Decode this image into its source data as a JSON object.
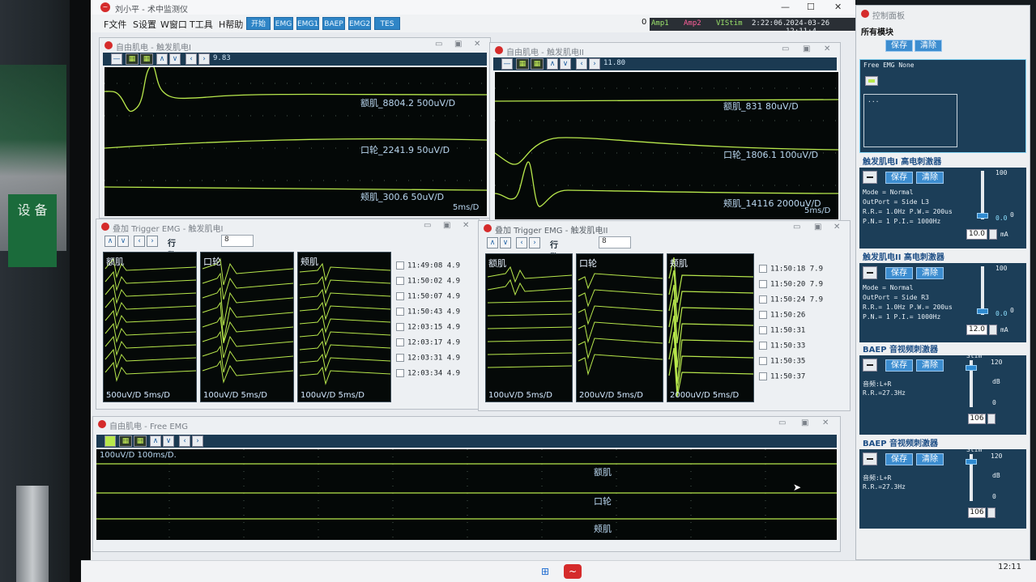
{
  "app": {
    "title": "刘小平 - 术中监测仪",
    "menu": [
      "F文件",
      "S设置",
      "W窗口",
      "T工具",
      "H帮助"
    ],
    "toolbar_buttons": [
      "开始",
      "EMG",
      "EMG1",
      "BAEP",
      "EMG2",
      "TES"
    ],
    "status": {
      "count": "0",
      "amp1": "Amp1",
      "amp2": "Amp2",
      "vistim": "VIStim",
      "elapsed": "2:22:06.",
      "datetime": "2024-03-26 12:11:4"
    }
  },
  "win1": {
    "title": "自由肌电 - 触发肌电I",
    "cursor_value": "9.83",
    "channels": [
      {
        "label": "额肌_8804.2  500uV/D"
      },
      {
        "label": "口轮_2241.9  50uV/D"
      },
      {
        "label": "颊肌_300.6  50uV/D"
      }
    ],
    "timebase": "5ms/D"
  },
  "win2": {
    "title": "自由肌电 - 触发肌电II",
    "cursor_value": "11.80",
    "channels": [
      {
        "label": "额肌_831  80uV/D"
      },
      {
        "label": "口轮_1806.1  100uV/D"
      },
      {
        "label": "颊肌_14116  2000uV/D"
      }
    ],
    "timebase": "5ms/D"
  },
  "trig1": {
    "title": "叠加 Trigger EMG - 触发肌电I",
    "rows_label": "行数",
    "rows_value": "8",
    "panels": [
      {
        "name": "额肌",
        "scale": "500uV/D 5ms/D"
      },
      {
        "name": "口轮",
        "scale": "100uV/D 5ms/D"
      },
      {
        "name": "颊肌",
        "scale": "100uV/D 5ms/D"
      }
    ],
    "entries": [
      "11:49:08 4.9",
      "11:50:02 4.9",
      "11:50:07 4.9",
      "11:50:43 4.9",
      "12:03:15 4.9",
      "12:03:17 4.9",
      "12:03:31 4.9",
      "12:03:34 4.9"
    ]
  },
  "trig2": {
    "title": "叠加 Trigger EMG - 触发肌电II",
    "rows_label": "行数",
    "rows_value": "8",
    "panels": [
      {
        "name": "额肌",
        "scale": "100uV/D 5ms/D"
      },
      {
        "name": "口轮",
        "scale": "200uV/D 5ms/D"
      },
      {
        "name": "颊肌",
        "scale": "2000uV/D 5ms/D"
      }
    ],
    "entries": [
      "11:50:18 7.9",
      "11:50:20 7.9",
      "11:50:24 7.9",
      "11:50:26",
      "11:50:31",
      "11:50:33",
      "11:50:35",
      "11:50:37"
    ]
  },
  "free": {
    "title": "自由肌电 - Free EMG",
    "scale": "100uV/D  100ms/D.",
    "channels": [
      "额肌",
      "口轮",
      "颊肌"
    ]
  },
  "cp": {
    "title": "控制面板",
    "all_modules": "所有模块",
    "save": "保存",
    "clear": "清除",
    "free_emg_label": "Free EMG  None",
    "free_emg_dots": "...",
    "stim1": {
      "head": "触发肌电I  高电刺激器",
      "mode": "Mode = Normal",
      "outport": "OutPort = Side L3",
      "rr": "R.R.= 1.0Hz  P.W.= 200us",
      "pn": "P.N.= 1   P.I.= 1000Hz",
      "max": "100",
      "min": "0",
      "current_readout": "0.0",
      "set": "10.0",
      "unit": "mA",
      "level": 0.0
    },
    "stim2": {
      "head": "触发肌电II  高电刺激器",
      "mode": "Mode = Normal",
      "outport": "OutPort = Side R3",
      "rr": "R.R.= 1.0Hz  P.W.= 200us",
      "pn": "P.N.= 1   P.I.= 1000Hz",
      "max": "100",
      "min": "0",
      "current_readout": "0.0",
      "set": "12.0",
      "unit": "mA",
      "level": 0.0
    },
    "baep1": {
      "head": "BAEP  音视频刺激器",
      "audio": "音频:L+R",
      "rr": "R.R.=27.3Hz",
      "stim": "Stim",
      "max": "120",
      "db": "dB",
      "min": "0",
      "set": "106"
    },
    "baep2": {
      "head": "BAEP  音视频刺激器",
      "audio": "音频:L+R",
      "rr": "R.R.=27.3Hz",
      "stim": "Stim",
      "max": "120",
      "db": "dB",
      "min": "0",
      "set": "106"
    }
  },
  "taskbar": {
    "clock": "12:11"
  },
  "photo": {
    "sign_text": "设 备"
  },
  "colors": {
    "trace": "#b8e84c",
    "plot_bg": "#040807",
    "accent": "#2f85c6",
    "panel_blue": "#1c3e58"
  }
}
